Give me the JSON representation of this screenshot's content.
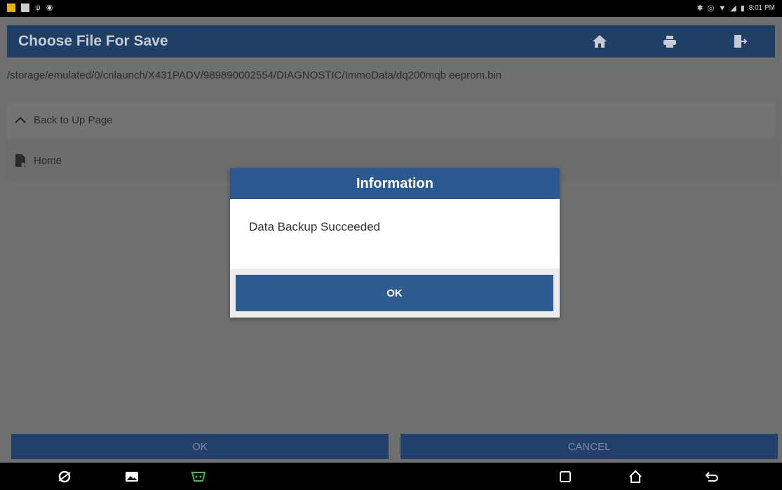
{
  "status_bar": {
    "time": "8:01 PM"
  },
  "titlebar": {
    "title": "Choose File For Save",
    "buttons": [
      {
        "icon": "home-icon"
      },
      {
        "icon": "printer-icon"
      },
      {
        "icon": "exit-icon"
      }
    ]
  },
  "path": "/storage/emulated/0/cnlaunch/X431PADV/989890002554/DIAGNOSTIC/ImmoData/dq200mqb eeprom.bin",
  "list": {
    "back_label": "Back to Up Page",
    "home_label": "Home"
  },
  "bottom": {
    "ok_label": "OK",
    "cancel_label": "CANCEL"
  },
  "dialog": {
    "title": "Information",
    "message": "Data Backup Succeeded",
    "ok_label": "OK"
  },
  "colors": {
    "title_bar": "#1f3f66",
    "dialog_header": "#2b5a90",
    "dialog_button": "#2e5b90",
    "obd_icon": "#3fbf3f"
  }
}
